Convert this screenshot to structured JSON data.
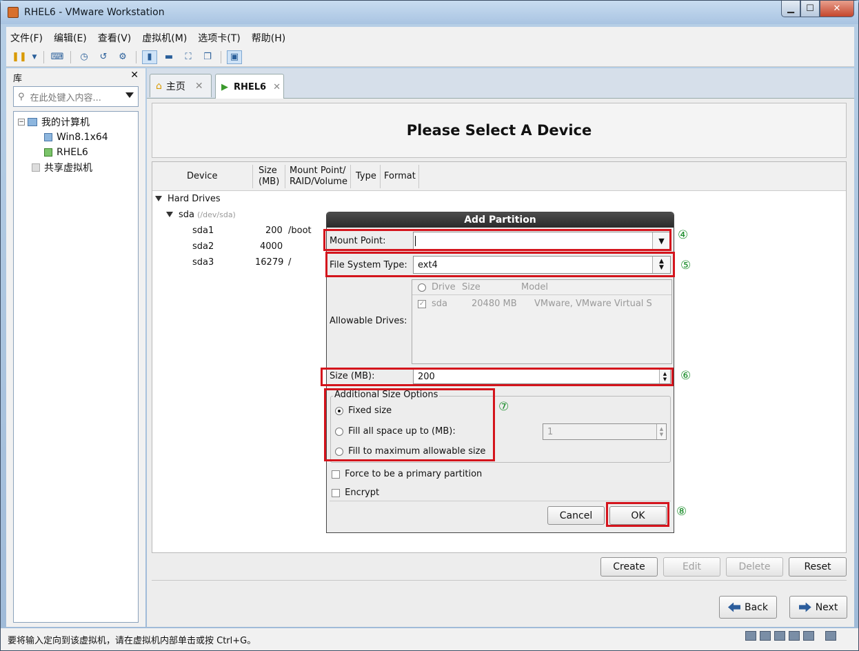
{
  "window": {
    "title": "RHEL6 - VMware Workstation"
  },
  "menu": [
    "文件(F)",
    "编辑(E)",
    "查看(V)",
    "虚拟机(M)",
    "选项卡(T)",
    "帮助(H)"
  ],
  "library": {
    "header": "库",
    "search_placeholder": "在此处键入内容...",
    "tree": {
      "root": "我的计算机",
      "vm1": "Win8.1x64",
      "vm2": "RHEL6",
      "shared": "共享虚拟机"
    }
  },
  "tabs": {
    "home": "主页",
    "vm": "RHEL6"
  },
  "installer": {
    "title": "Please Select A Device",
    "columns": {
      "device": "Device",
      "size1": "Size",
      "size2": "(MB)",
      "mount1": "Mount Point/",
      "mount2": "RAID/Volume",
      "type": "Type",
      "format": "Format"
    },
    "hard_drives": "Hard Drives",
    "sda": "sda",
    "sda_path": "(/dev/sda)",
    "partitions": [
      {
        "name": "sda1",
        "size": "200",
        "mount": "/boot"
      },
      {
        "name": "sda2",
        "size": "4000",
        "mount": ""
      },
      {
        "name": "sda3",
        "size": "16279",
        "mount": "/"
      }
    ],
    "buttons": {
      "create": "Create",
      "edit": "Edit",
      "delete": "Delete",
      "reset": "Reset",
      "back": "Back",
      "next": "Next"
    }
  },
  "dialog": {
    "title": "Add Partition",
    "mount_label": "Mount Point:",
    "mount_value": "",
    "fs_label": "File System Type:",
    "fs_value": "ext4",
    "drives_label": "Allowable Drives:",
    "drive_cols": {
      "drive": "Drive",
      "size": "Size",
      "model": "Model"
    },
    "drive_row": {
      "drive": "sda",
      "size": "20480 MB",
      "model": "VMware, VMware Virtual S"
    },
    "size_label": "Size (MB):",
    "size_value": "200",
    "options_title": "Additional Size Options",
    "opt_fixed": "Fixed size",
    "opt_fill_upto": "Fill all space up to (MB):",
    "opt_fill_upto_value": "1",
    "opt_fill_max": "Fill to maximum allowable size",
    "force_primary": "Force to be a primary partition",
    "encrypt": "Encrypt",
    "cancel": "Cancel",
    "ok": "OK"
  },
  "annotations": [
    "④",
    "⑤",
    "⑥",
    "⑦",
    "⑧"
  ],
  "status": {
    "text": "要将输入定向到该虚拟机，请在虚拟机内部单击或按 Ctrl+G。"
  },
  "colors": {
    "highlight": "#d4141c",
    "annotation": "#1a8c2a"
  }
}
